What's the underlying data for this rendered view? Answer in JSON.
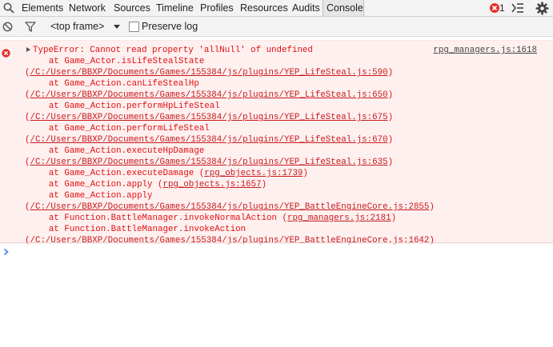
{
  "tabs": [
    {
      "label": "Elements",
      "active": false
    },
    {
      "label": "Network",
      "active": false
    },
    {
      "label": "Sources",
      "active": false
    },
    {
      "label": "Timeline",
      "active": false
    },
    {
      "label": "Profiles",
      "active": false
    },
    {
      "label": "Resources",
      "active": false
    },
    {
      "label": "Audits",
      "active": false
    },
    {
      "label": "Console",
      "active": true
    }
  ],
  "status": {
    "error_count": "1"
  },
  "toolbar": {
    "frame_label": "<top frame>",
    "preserve_log_label": "Preserve log",
    "preserve_log_checked": false
  },
  "error": {
    "source_link": "rpg_managers.js:1618",
    "message": "TypeError: Cannot read property 'allNull' of undefined",
    "stack": [
      {
        "text": "    at Game_Actor.isLifeStealState",
        "link": ""
      },
      {
        "text": "(",
        "link": "/C:/Users/BBXP/Documents/Games/155384/js/plugins/YEP_LifeSteal.js:590",
        "close": ")"
      },
      {
        "text": "    at Game_Action.canLifeStealHp",
        "link": ""
      },
      {
        "text": "(",
        "link": "/C:/Users/BBXP/Documents/Games/155384/js/plugins/YEP_LifeSteal.js:650",
        "close": ")"
      },
      {
        "text": "    at Game_Action.performHpLifeSteal",
        "link": ""
      },
      {
        "text": "(",
        "link": "/C:/Users/BBXP/Documents/Games/155384/js/plugins/YEP_LifeSteal.js:675",
        "close": ")"
      },
      {
        "text": "    at Game_Action.performLifeSteal",
        "link": ""
      },
      {
        "text": "(",
        "link": "/C:/Users/BBXP/Documents/Games/155384/js/plugins/YEP_LifeSteal.js:670",
        "close": ")"
      },
      {
        "text": "    at Game_Action.executeHpDamage",
        "link": ""
      },
      {
        "text": "(",
        "link": "/C:/Users/BBXP/Documents/Games/155384/js/plugins/YEP_LifeSteal.js:635",
        "close": ")"
      },
      {
        "text": "    at Game_Action.executeDamage (",
        "link": "rpg_objects.js:1739",
        "close": ")"
      },
      {
        "text": "    at Game_Action.apply (",
        "link": "rpg_objects.js:1657",
        "close": ")"
      },
      {
        "text": "    at Game_Action.apply",
        "link": ""
      },
      {
        "text": "(",
        "link": "/C:/Users/BBXP/Documents/Games/155384/js/plugins/YEP_BattleEngineCore.js:2855",
        "close": ")"
      },
      {
        "text": "    at Function.BattleManager.invokeNormalAction (",
        "link": "rpg_managers.js:2181",
        "close": ")"
      },
      {
        "text": "    at Function.BattleManager.invokeAction",
        "link": ""
      },
      {
        "text": "(",
        "link": "/C:/Users/BBXP/Documents/Games/155384/js/plugins/YEP_BattleEngineCore.js:1642",
        "close": ")"
      }
    ]
  },
  "colors": {
    "error_text": "#e01010",
    "error_bg": "#fff0f0",
    "prompt": "#367cf1"
  },
  "icons": [
    "search-icon",
    "error-badge-icon",
    "drawer-icon",
    "gear-icon",
    "clear-console-icon",
    "filter-icon",
    "error-icon",
    "expand-triangle-icon",
    "prompt-chevron-icon"
  ]
}
